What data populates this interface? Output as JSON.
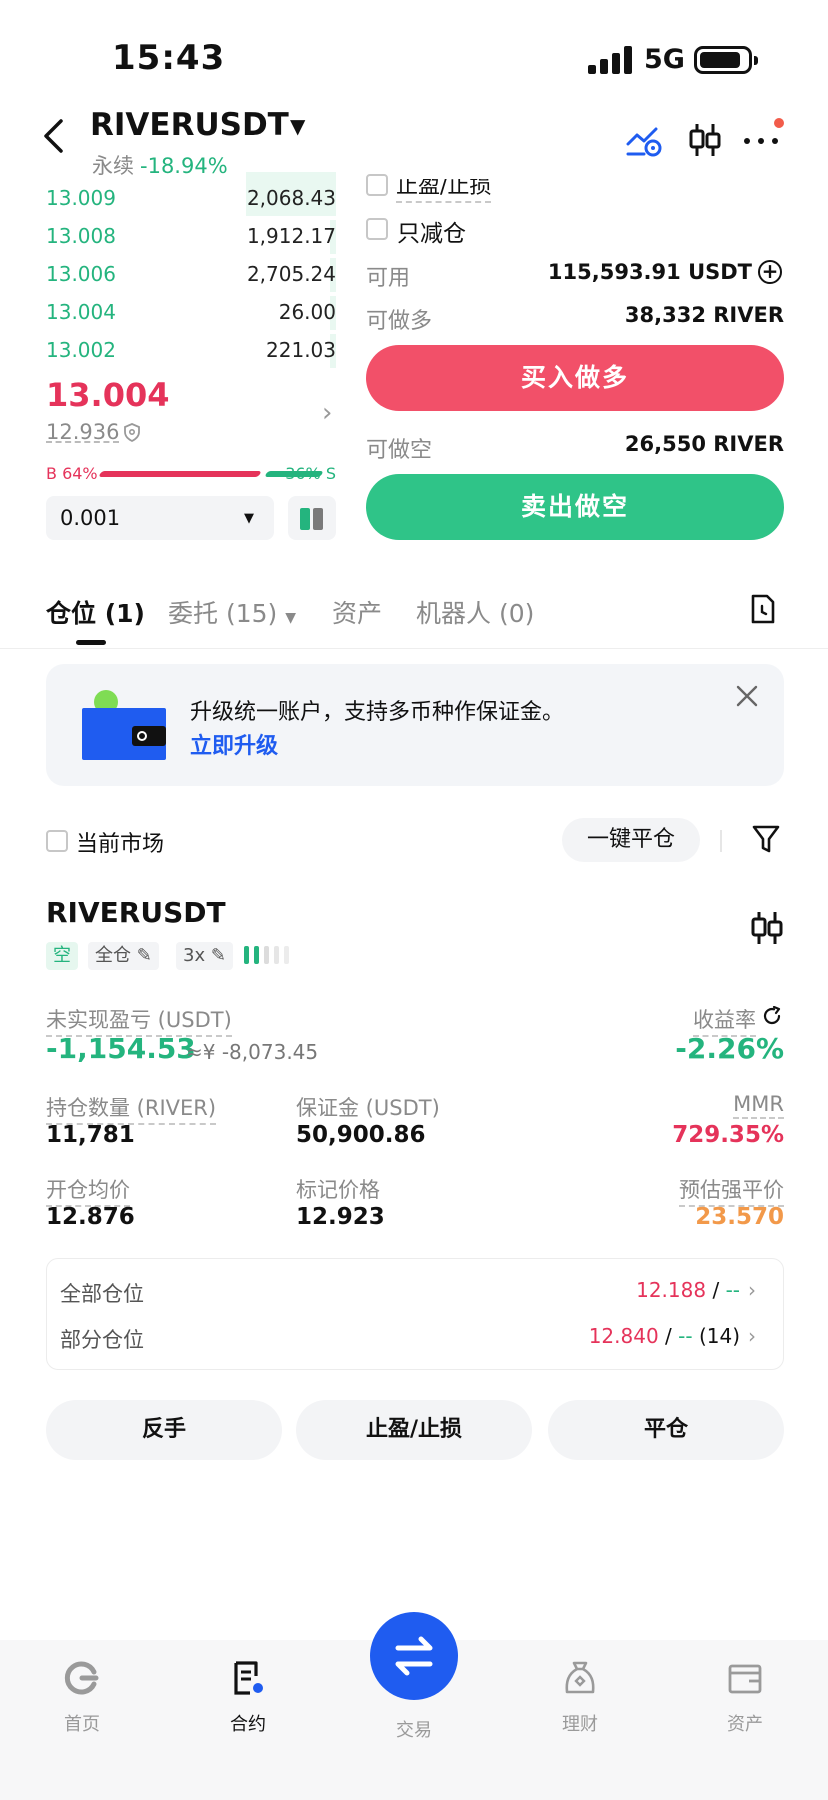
{
  "status_bar": {
    "time": "15:43",
    "network": "5G"
  },
  "header": {
    "symbol": "RIVERUSDT",
    "contract_type": "永续",
    "change": "-18.94%"
  },
  "order_book": {
    "bids": [
      {
        "price": "13.009",
        "qty": "2,068.43",
        "depth": 0.31
      },
      {
        "price": "13.008",
        "qty": "1,912.17",
        "depth": 0.0
      },
      {
        "price": "13.006",
        "qty": "2,705.24",
        "depth": 0.0
      },
      {
        "price": "13.004",
        "qty": "26.00",
        "depth": 0.0
      },
      {
        "price": "13.002",
        "qty": "221.03",
        "depth": 0.0
      }
    ],
    "last_price": "13.004",
    "mark_price": "12.936",
    "buy_ratio": "B 64%",
    "sell_ratio": "36% S",
    "precision": "0.001"
  },
  "order_panel": {
    "tp_sl_label": "止盈/止损",
    "reduce_only_label": "只减仓",
    "available_label": "可用",
    "available_value": "115,593.91 USDT",
    "can_long_label": "可做多",
    "can_long_value": "38,332 RIVER",
    "buy_button": "买入做多",
    "can_short_label": "可做空",
    "can_short_value": "26,550 RIVER",
    "sell_button": "卖出做空"
  },
  "tabs": [
    {
      "label": "仓位 (1)"
    },
    {
      "label": "委托 (15)"
    },
    {
      "label": "资产"
    },
    {
      "label": "机器人 (0)"
    }
  ],
  "banner": {
    "text": "升级统一账户，支持多币种作保证金。",
    "link": "立即升级"
  },
  "filter": {
    "current_market_label": "当前市场",
    "close_all_button": "一键平仓"
  },
  "position": {
    "symbol": "RIVERUSDT",
    "side_tag": "空",
    "margin_mode_tag": "全仓",
    "leverage_tag": "3x",
    "upl_label": "未实现盈亏 (USDT)",
    "upl_value": "-1,154.53",
    "upl_cny": "≈¥ -8,073.45",
    "roe_label": "收益率",
    "roe_value": "-2.26%",
    "size_label": "持仓数量 (RIVER)",
    "size_value": "11,781",
    "margin_label": "保证金 (USDT)",
    "margin_value": "50,900.86",
    "mmr_label": "MMR",
    "mmr_value": "729.35%",
    "entry_label": "开仓均价",
    "entry_value": "12.876",
    "mark_label": "标记价格",
    "mark_value": "12.923",
    "liq_label": "预估强平价",
    "liq_value": "23.570",
    "tpsl_full_label": "全部仓位",
    "tpsl_full_tp": "12.188",
    "tpsl_full_sl": "--",
    "tpsl_partial_label": "部分仓位",
    "tpsl_partial_tp": "12.840",
    "tpsl_partial_sl": "--",
    "tpsl_partial_count": "(14)",
    "tpsl_sep": "/",
    "reverse_button": "反手",
    "tpsl_button": "止盈/止损",
    "close_button": "平仓"
  },
  "bottom_nav": [
    {
      "label": "首页",
      "icon": "home-icon"
    },
    {
      "label": "合约",
      "icon": "contract-icon"
    },
    {
      "label": "交易",
      "icon": "trade-swap-icon"
    },
    {
      "label": "理财",
      "icon": "earn-icon"
    },
    {
      "label": "资产",
      "icon": "wallet-icon"
    }
  ],
  "colors": {
    "up_green": "#24b47e",
    "down_red": "#e5335a",
    "buy_button": "#f25069",
    "sell_button": "#2fc488",
    "accent_blue": "#1f5cf0",
    "liq_orange": "#f2994a"
  }
}
